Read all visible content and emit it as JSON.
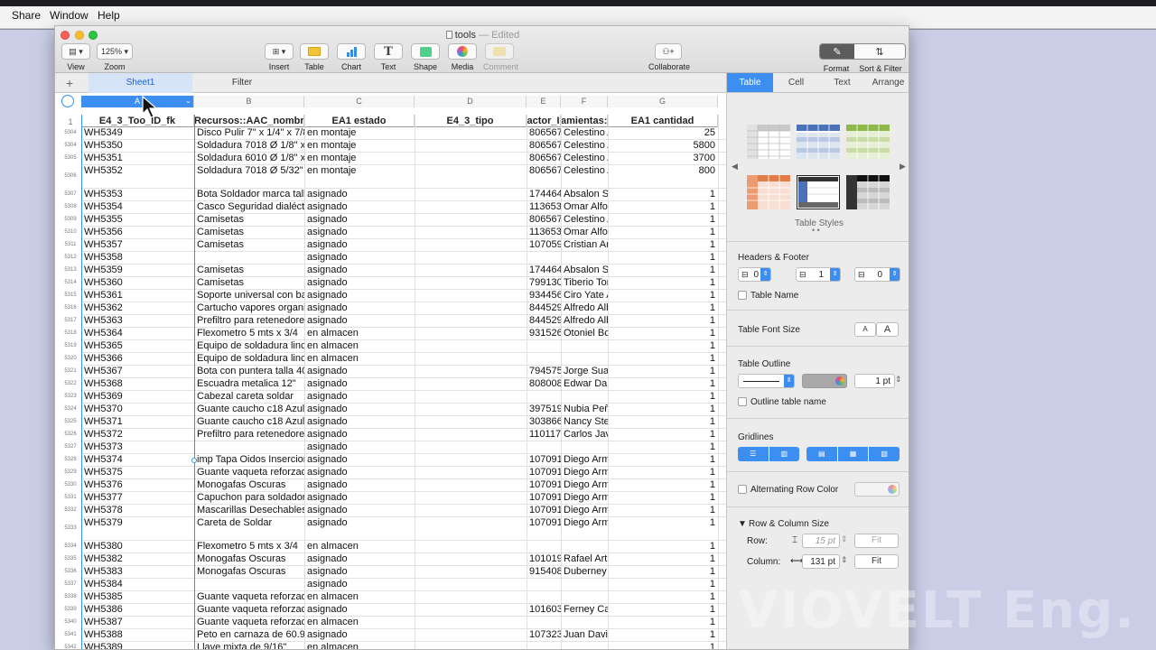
{
  "menubar": {
    "items": [
      "Share",
      "Window",
      "Help"
    ]
  },
  "window": {
    "title": "tools",
    "edited": "— Edited"
  },
  "toolbar": {
    "view": "View",
    "zoom": "Zoom",
    "zoom_value": "125%",
    "insert": "Insert",
    "table": "Table",
    "chart": "Chart",
    "text": "Text",
    "shape": "Shape",
    "media": "Media",
    "comment": "Comment",
    "collaborate": "Collaborate",
    "format": "Format",
    "sort_filter": "Sort & Filter"
  },
  "sheets": {
    "active": "Sheet1",
    "filter": "Filter"
  },
  "columns": [
    "A",
    "B",
    "C",
    "D",
    "E",
    "F",
    "G"
  ],
  "header_row_num": "1",
  "headers": [
    "E4_3_Too_ID_fk",
    "Recursos::AAC_nombre",
    "EA1 estado",
    "E4_3_tipo",
    "actor_I",
    "amientas:",
    "EA1 cantidad"
  ],
  "rows": [
    {
      "n": "5304",
      "a": "WH5349",
      "b": "Disco Pulir 7\" x 1/4\" x 7/8",
      "c": "en montaje",
      "d": "",
      "e": "806567",
      "f": "Celestino A",
      "g": "25"
    },
    {
      "n": "5304",
      "a": "WH5350",
      "b": "Soldadura 7018 Ø 1/8\" x 14\"",
      "c": "en montaje",
      "d": "",
      "e": "806567",
      "f": "Celestino A",
      "g": "5800"
    },
    {
      "n": "5305",
      "a": "WH5351",
      "b": "Soldadura 6010 Ø 1/8\" x 14\"",
      "c": "en montaje",
      "d": "",
      "e": "806567",
      "f": "Celestino A",
      "g": "3700"
    },
    {
      "n": "5306",
      "a": "WH5352",
      "b": "Soldadura 7018 Ø 5/32\" x 14\"",
      "c": "en montaje",
      "d": "",
      "e": "806567",
      "f": "Celestino A",
      "g": "800"
    },
    {
      "n": "5307",
      "a": "WH5353",
      "b": "Bota Soldador marca talla 40",
      "c": "asignado",
      "d": "",
      "e": "174464",
      "f": "Absalon Sa",
      "g": "1"
    },
    {
      "n": "5308",
      "a": "WH5354",
      "b": "Casco Seguridad dialéctico",
      "c": "asignado",
      "d": "",
      "e": "113653",
      "f": "Omar Alfon",
      "g": "1"
    },
    {
      "n": "5309",
      "a": "WH5355",
      "b": "Camisetas",
      "c": "asignado",
      "d": "",
      "e": "806567",
      "f": "Celestino A",
      "g": "1"
    },
    {
      "n": "5310",
      "a": "WH5356",
      "b": "Camisetas",
      "c": "asignado",
      "d": "",
      "e": "113653",
      "f": "Omar Alfon",
      "g": "1"
    },
    {
      "n": "5311",
      "a": "WH5357",
      "b": "Camisetas",
      "c": "asignado",
      "d": "",
      "e": "107059",
      "f": "Cristian Ar",
      "g": "1"
    },
    {
      "n": "5312",
      "a": "WH5358",
      "b": "",
      "c": "asignado",
      "d": "",
      "e": "",
      "f": "",
      "g": "1"
    },
    {
      "n": "5313",
      "a": "WH5359",
      "b": "Camisetas",
      "c": "asignado",
      "d": "",
      "e": "174464",
      "f": "Absalon Sa",
      "g": "1"
    },
    {
      "n": "5314",
      "a": "WH5360",
      "b": "Camisetas",
      "c": "asignado",
      "d": "",
      "e": "799130",
      "f": "Tiberio Tor",
      "g": "1"
    },
    {
      "n": "5315",
      "a": "WH5361",
      "b": "Soporte universal con base",
      "c": "asignado",
      "d": "",
      "e": "934456",
      "f": "Ciro Yate A",
      "g": "1"
    },
    {
      "n": "5316",
      "a": "WH5362",
      "b": "Cartucho vapores organicos",
      "c": "asignado",
      "d": "",
      "e": "844529",
      "f": "Alfredo Alb",
      "g": "1"
    },
    {
      "n": "5317",
      "a": "WH5363",
      "b": "Prefiltro para retenedores",
      "c": "asignado",
      "d": "",
      "e": "844529",
      "f": "Alfredo Alb",
      "g": "1"
    },
    {
      "n": "5318",
      "a": "WH5364",
      "b": "Flexometro 5 mts x 3/4",
      "c": "en almacen",
      "d": "",
      "e": "931526",
      "f": "Otoniel Bo",
      "g": "1"
    },
    {
      "n": "5319",
      "a": "WH5365",
      "b": "Equipo de soldadura lincoln",
      "c": "en almacen",
      "d": "",
      "e": "",
      "f": "",
      "g": "1"
    },
    {
      "n": "5320",
      "a": "WH5366",
      "b": "Equipo de soldadura lincoln",
      "c": "en almacen",
      "d": "",
      "e": "",
      "f": "",
      "g": "1"
    },
    {
      "n": "5321",
      "a": "WH5367",
      "b": "Bota con puntera  talla 40",
      "c": "asignado",
      "d": "",
      "e": "794575",
      "f": "Jorge Suar",
      "g": "1"
    },
    {
      "n": "5322",
      "a": "WH5368",
      "b": "Escuadra metalica  12\"",
      "c": "asignado",
      "d": "",
      "e": "808008",
      "f": "Edwar Dar",
      "g": "1"
    },
    {
      "n": "5323",
      "a": "WH5369",
      "b": "Cabezal careta soldar",
      "c": "asignado",
      "d": "",
      "e": "",
      "f": "",
      "g": "1"
    },
    {
      "n": "5324",
      "a": "WH5370",
      "b": "Guante caucho c18 Azul talla",
      "c": "asignado",
      "d": "",
      "e": "397519",
      "f": "Nubia Peña",
      "g": "1"
    },
    {
      "n": "5325",
      "a": "WH5371",
      "b": "Guante caucho c18 Azul talla",
      "c": "asignado",
      "d": "",
      "e": "303866",
      "f": "Nancy Stel",
      "g": "1"
    },
    {
      "n": "5326",
      "a": "WH5372",
      "b": "Prefiltro para retenedores",
      "c": "asignado",
      "d": "",
      "e": "110117",
      "f": "Carlos Javi",
      "g": "1"
    },
    {
      "n": "5327",
      "a": "WH5373",
      "b": "",
      "c": "asignado",
      "d": "",
      "e": "",
      "f": "",
      "g": "1"
    },
    {
      "n": "5328",
      "a": "WH5374",
      "b": "imp Tapa Oidos Insercion",
      "c": "asignado",
      "d": "",
      "e": "107091",
      "f": "Diego Arm",
      "g": "1"
    },
    {
      "n": "5329",
      "a": "WH5375",
      "b": "Guante vaqueta reforzado",
      "c": "asignado",
      "d": "",
      "e": "107091",
      "f": "Diego Arm",
      "g": "1"
    },
    {
      "n": "5330",
      "a": "WH5376",
      "b": "Monogafas Oscuras",
      "c": "asignado",
      "d": "",
      "e": "107091",
      "f": "Diego Arm",
      "g": "1"
    },
    {
      "n": "5331",
      "a": "WH5377",
      "b": "Capuchon para soldador",
      "c": "asignado",
      "d": "",
      "e": "107091",
      "f": "Diego Arm",
      "g": "1"
    },
    {
      "n": "5332",
      "a": "WH5378",
      "b": "Mascarillas Desechables ref",
      "c": "asignado",
      "d": "",
      "e": "107091",
      "f": "Diego Arm",
      "g": "1"
    },
    {
      "n": "5333",
      "a": "WH5379",
      "b": "Careta de Soldar",
      "c": "asignado",
      "d": "",
      "e": "107091",
      "f": "Diego Arm",
      "g": "1"
    },
    {
      "n": "5334",
      "a": "WH5380",
      "b": "Flexometro 5 mts x 3/4",
      "c": "en almacen",
      "d": "",
      "e": "",
      "f": "",
      "g": "1"
    },
    {
      "n": "5335",
      "a": "WH5382",
      "b": "Monogafas Oscuras",
      "c": "asignado",
      "d": "",
      "e": "101019",
      "f": "Rafael Artu",
      "g": "1"
    },
    {
      "n": "5336",
      "a": "WH5383",
      "b": "Monogafas Oscuras",
      "c": "asignado",
      "d": "",
      "e": "915408",
      "f": "Duberney",
      "g": "1"
    },
    {
      "n": "5337",
      "a": "WH5384",
      "b": "",
      "c": "asignado",
      "d": "",
      "e": "",
      "f": "",
      "g": "1"
    },
    {
      "n": "5338",
      "a": "WH5385",
      "b": "Guante vaqueta reforzado",
      "c": "en almacen",
      "d": "",
      "e": "",
      "f": "",
      "g": "1"
    },
    {
      "n": "5339",
      "a": "WH5386",
      "b": "Guante vaqueta reforzado",
      "c": "asignado",
      "d": "",
      "e": "101603",
      "f": "Ferney Cac",
      "g": "1"
    },
    {
      "n": "5340",
      "a": "WH5387",
      "b": "Guante vaqueta reforzado",
      "c": "en almacen",
      "d": "",
      "e": "",
      "f": "",
      "g": "1"
    },
    {
      "n": "5341",
      "a": "WH5388",
      "b": "Peto en carnaza de 60.90",
      "c": "asignado",
      "d": "",
      "e": "107323",
      "f": "Juan David",
      "g": "1"
    },
    {
      "n": "5342",
      "a": "WH5389",
      "b": "Llave mixta de 9/16\"",
      "c": "en almacen",
      "d": "",
      "e": "",
      "f": "",
      "g": "1"
    }
  ],
  "panel": {
    "tabs": [
      "Table",
      "Cell",
      "Text",
      "Arrange"
    ],
    "table_styles_label": "Table Styles",
    "headers_footer": "Headers & Footer",
    "header_rows": "0",
    "header_cols": "1",
    "footer_rows": "0",
    "table_name": "Table Name",
    "table_font_size": "Table Font Size",
    "font_small": "A",
    "font_big": "A",
    "table_outline": "Table Outline",
    "outline_width": "1 pt",
    "outline_table_name": "Outline table name",
    "gridlines": "Gridlines",
    "alternating_row_color": "Alternating Row Color",
    "row_col_size": "Row & Column Size",
    "row_label": "Row:",
    "row_value": "15 pt",
    "fit": "Fit",
    "column_label": "Column:",
    "column_value": "131 pt"
  },
  "watermark": "VIOVELT Eng.",
  "colors": {
    "accent": "#3c8ef0",
    "sheet_tab": "#d7e4f7"
  }
}
